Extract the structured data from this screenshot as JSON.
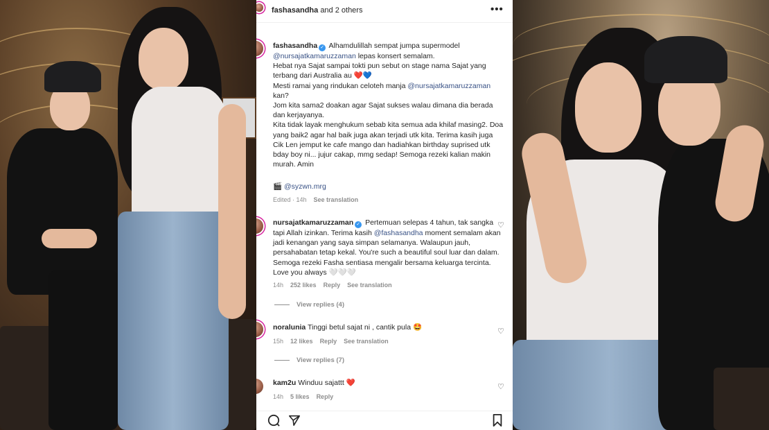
{
  "header": {
    "username": "fashasandha",
    "others": "and 2 others",
    "more_icon": "more-options-icon"
  },
  "caption": {
    "username": "fashasandha",
    "p1": "Alhamdulillah sempat jumpa supermodel",
    "mention1": "@nursajatkamaruzzaman",
    "p2": "lepas konsert semalam.\nHebat nya Sajat sampai tokti pun sebut on stage nama Sajat yang terbang dari Australia au",
    "p3": "\nMesti ramai yang rindukan celoteh manja",
    "mention2": "@nursajatkamaruzzaman",
    "p4": "kan?\nJom kita sama2 doakan agar Sajat sukses walau dimana dia berada dan kerjayanya.\nKita tidak layak menghukum sebab kita semua ada khilaf masing2. Doa yang baik2 agar hal baik juga akan terjadi utk kita. Terima kasih juga Cik Len jemput ke cafe mango dan hadiahkan birthday suprised utk bday boy ni... jujur cakap, mmg sedap! Semoga rezeki kalian makin murah. Amin",
    "credit_mention": "@syzwn.mrg",
    "edited": "Edited · 14h",
    "see_translation": "See translation"
  },
  "comments": [
    {
      "username": "nursajatkamaruzzaman",
      "text_a": "Pertemuan selepas 4 tahun, tak sangka tapi Allah izinkan. Terima kasih",
      "mention": "@fashasandha",
      "text_b": "moment semalam akan jadi kenangan yang saya simpan selamanya. Walaupun jauh, persahabatan tetap kekal. You're such a beautiful soul luar dan dalam. Semoga rezeki Fasha sentiasa mengalir bersama keluarga tercinta. Love you always 🤍🤍🤍",
      "time": "14h",
      "likes": "252 likes",
      "reply": "Reply",
      "see_translation": "See translation",
      "view_replies": "View replies (4)"
    },
    {
      "username": "noralunia",
      "text": "Tinggi betul sajat ni , cantik pula 🤩",
      "time": "15h",
      "likes": "12 likes",
      "reply": "Reply",
      "see_translation": "See translation",
      "view_replies": "View replies (7)"
    },
    {
      "username": "kam2u",
      "text": "Winduu sajattt",
      "time": "14h",
      "likes": "5 likes",
      "reply": "Reply"
    }
  ],
  "icons": {
    "clapper": "🎬",
    "heart_red": "❤️",
    "heart_blue": "💙",
    "red_heart_small": "❤️"
  },
  "colors": {
    "mention": "#385185",
    "verified": "#3897f0",
    "meta": "#8e8e8e"
  }
}
